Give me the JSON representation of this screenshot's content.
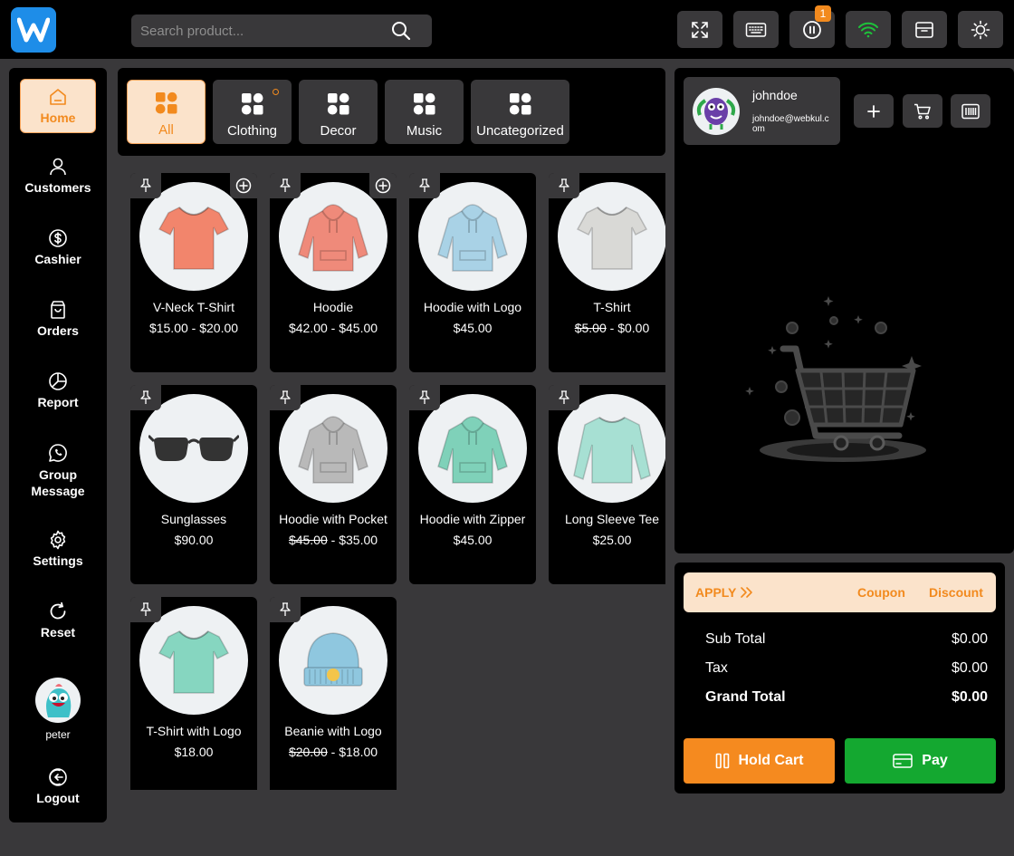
{
  "header": {
    "search_placeholder": "Search product...",
    "pause_badge": "1"
  },
  "sidebar": {
    "items": [
      {
        "label": "Home",
        "icon": "home-icon"
      },
      {
        "label": "Customers",
        "icon": "user-icon"
      },
      {
        "label": "Cashier",
        "icon": "dollar-icon"
      },
      {
        "label": "Orders",
        "icon": "bag-icon"
      },
      {
        "label": "Report",
        "icon": "pie-chart-icon"
      },
      {
        "label": "Group Message",
        "icon": "whatsapp-icon"
      },
      {
        "label": "Settings",
        "icon": "gear-icon"
      },
      {
        "label": "Reset",
        "icon": "refresh-icon"
      },
      {
        "label": "Logout",
        "icon": "logout-icon"
      }
    ],
    "user_name": "peter"
  },
  "categories": [
    {
      "label": "All"
    },
    {
      "label": "Clothing"
    },
    {
      "label": "Decor"
    },
    {
      "label": "Music"
    },
    {
      "label": "Uncategorized"
    }
  ],
  "products": [
    {
      "name": "V-Neck T-Shirt",
      "price": "$15.00 - $20.00",
      "old_price": "",
      "kind": "tshirt",
      "color": "#f2856c",
      "plus": true
    },
    {
      "name": "Hoodie",
      "price": "$42.00 - $45.00",
      "old_price": "",
      "kind": "hoodie",
      "color": "#ef8a7a",
      "plus": true
    },
    {
      "name": "Hoodie with Logo",
      "price": "$45.00",
      "old_price": "",
      "kind": "hoodie",
      "color": "#a9d2e6",
      "plus": false
    },
    {
      "name": "T-Shirt",
      "price": "$0.00",
      "old_price": "$5.00",
      "kind": "tshirt",
      "color": "#d9d9d6",
      "plus": false
    },
    {
      "name": "Sunglasses",
      "price": "$90.00",
      "old_price": "",
      "kind": "glasses",
      "color": "#333333",
      "plus": false
    },
    {
      "name": "Hoodie with Pocket",
      "price": "$35.00",
      "old_price": "$45.00",
      "kind": "hoodie",
      "color": "#b9b9b9",
      "plus": false
    },
    {
      "name": "Hoodie with Zipper",
      "price": "$45.00",
      "old_price": "",
      "kind": "hoodie",
      "color": "#7fd1b9",
      "plus": false
    },
    {
      "name": "Long Sleeve Tee",
      "price": "$25.00",
      "old_price": "",
      "kind": "longsleeve",
      "color": "#a7e0d3",
      "plus": false
    },
    {
      "name": "T-Shirt with Logo",
      "price": "$18.00",
      "old_price": "",
      "kind": "tshirt",
      "color": "#86d6c0",
      "plus": false
    },
    {
      "name": "Beanie with Logo",
      "price": "$18.00",
      "old_price": "$20.00",
      "kind": "beanie",
      "color": "#8fc7df",
      "plus": false
    }
  ],
  "customer": {
    "name": "johndoe",
    "email": "johndoe@webkul.com"
  },
  "totals": {
    "apply_label": "APPLY",
    "coupon_label": "Coupon",
    "discount_label": "Discount",
    "sub_total_label": "Sub Total",
    "sub_total": "$0.00",
    "tax_label": "Tax",
    "tax": "$0.00",
    "grand_total_label": "Grand Total",
    "grand_total": "$0.00",
    "hold_cart_label": "Hold Cart",
    "pay_label": "Pay"
  },
  "colors": {
    "accent_orange": "#f28a1e",
    "pay_green": "#14a830",
    "logo_blue": "#1e8de8",
    "wifi_green": "#1ec23a"
  }
}
